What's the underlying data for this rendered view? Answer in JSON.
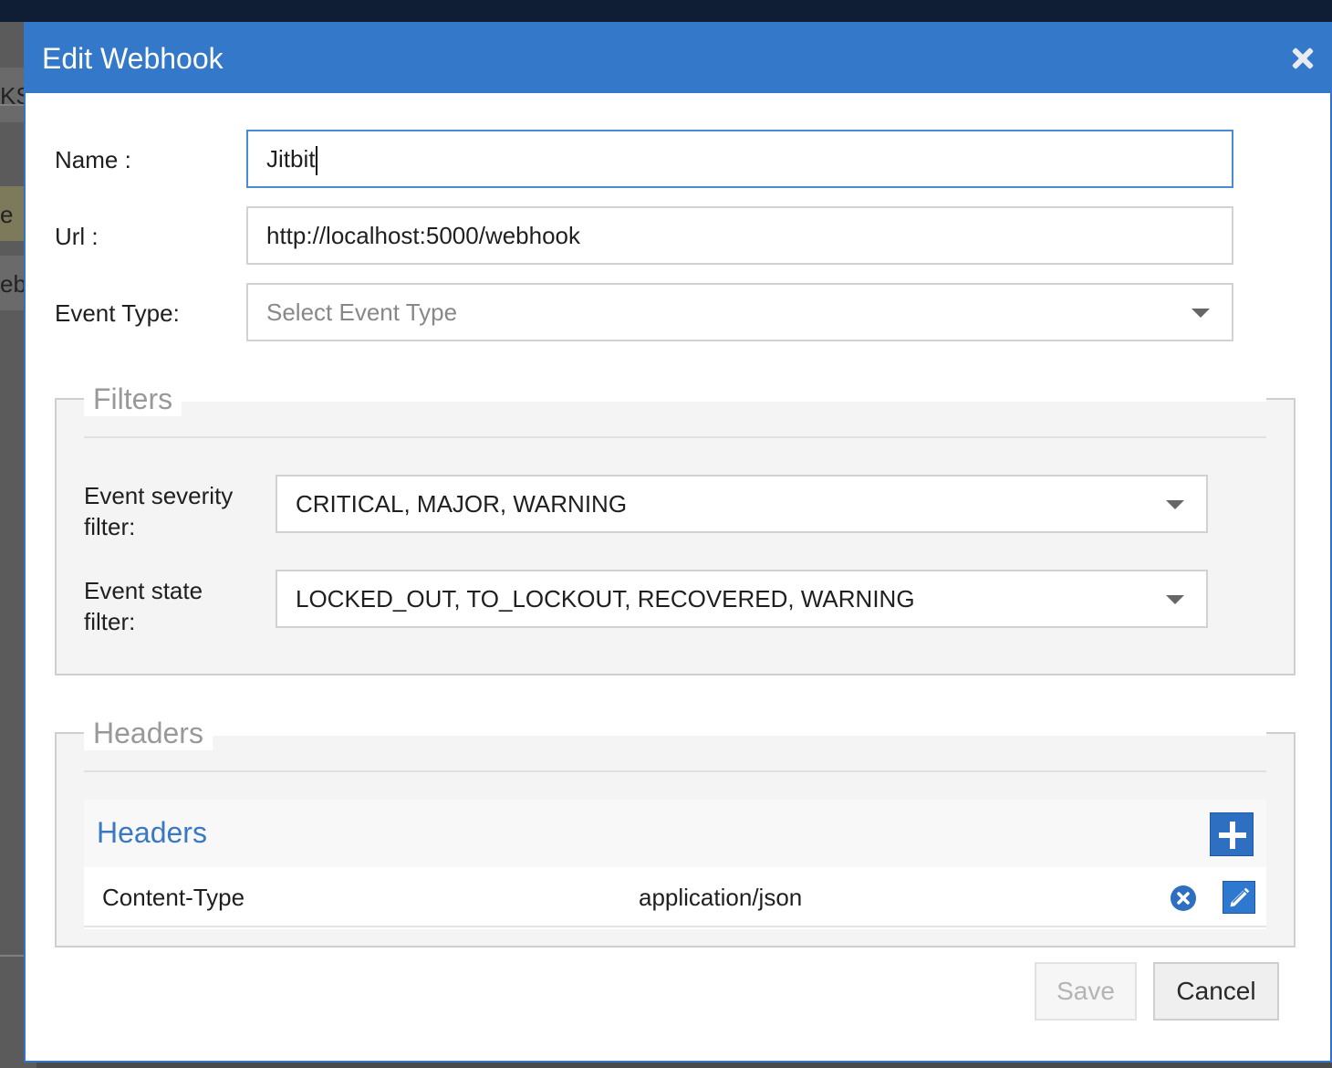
{
  "background": {
    "fragment_1": "KS",
    "fragment_2": "e",
    "fragment_3": "ebl"
  },
  "dialog": {
    "title": "Edit Webhook",
    "close_icon": "close-icon"
  },
  "form": {
    "name_label": "Name :",
    "name_value": "Jitbit",
    "url_label": "Url :",
    "url_value": "http://localhost:5000/webhook",
    "event_type_label": "Event Type:",
    "event_type_placeholder": "Select Event Type"
  },
  "filters": {
    "legend": "Filters",
    "severity_label_line1": "Event severity",
    "severity_label_line2": "filter:",
    "severity_value": "CRITICAL, MAJOR, WARNING",
    "state_label_line1": "Event state",
    "state_label_line2": "filter:",
    "state_value": "LOCKED_OUT, TO_LOCKOUT, RECOVERED, WARNING"
  },
  "headers": {
    "legend": "Headers",
    "panel_title": "Headers",
    "add_icon": "plus-icon",
    "rows": [
      {
        "key": "Content-Type",
        "value": "application/json"
      }
    ]
  },
  "buttons": {
    "save_label": "Save",
    "cancel_label": "Cancel"
  },
  "colors": {
    "header_bar": "#3478c9",
    "accent": "#3a78c3",
    "add_button": "#2f6fc2"
  }
}
